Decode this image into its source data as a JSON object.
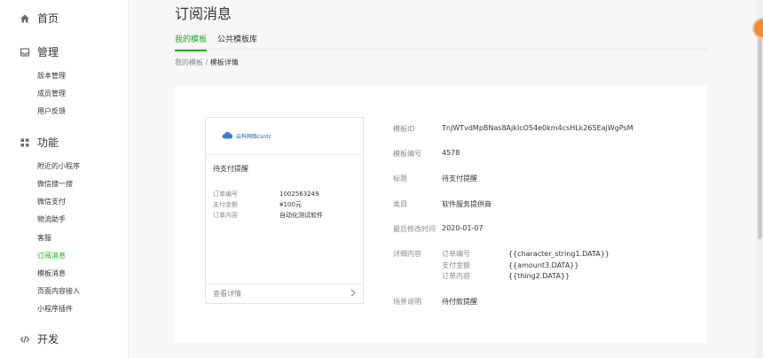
{
  "sidebar": {
    "home": {
      "label": "首页",
      "icon": "home-icon"
    },
    "manage": {
      "label": "管理",
      "icon": "inbox-icon",
      "items": [
        {
          "label": "版本管理"
        },
        {
          "label": "成员管理"
        },
        {
          "label": "用户反馈"
        }
      ]
    },
    "features": {
      "label": "功能",
      "icon": "grid-icon",
      "items": [
        {
          "label": "附近的小程序"
        },
        {
          "label": "微信搜一搜"
        },
        {
          "label": "微信支付"
        },
        {
          "label": "物流助手"
        },
        {
          "label": "客服"
        },
        {
          "label": "订阅消息"
        },
        {
          "label": "模板消息"
        },
        {
          "label": "页面内容接入"
        },
        {
          "label": "小程序插件"
        }
      ]
    },
    "develop": {
      "label": "开发",
      "icon": "code-icon"
    }
  },
  "page": {
    "title": "订阅消息",
    "tabs": [
      {
        "label": "我的模板"
      },
      {
        "label": "公共模板库"
      }
    ],
    "breadcrumb": {
      "parent": "我的模板",
      "separator": "/",
      "current": "模板详情"
    }
  },
  "preview": {
    "logo_text": "云科网络csntc",
    "title": "待支付提醒",
    "rows": [
      {
        "key": "订单编号",
        "value": "1002563249"
      },
      {
        "key": "支付金额",
        "value": "¥100元"
      },
      {
        "key": "订单内容",
        "value": "自动化测试软件"
      }
    ],
    "footer": "查看详情",
    "footer_icon": "chevron-right-icon"
  },
  "detail": {
    "template_id_label": "模板ID",
    "template_id": "TnJWTvdMpBNas8AjkIcO54e0km4csHLk265EajWgPsM",
    "template_no_label": "模板编号",
    "template_no": "4578",
    "title_label": "标题",
    "title": "待支付提醒",
    "category_label": "类目",
    "category": "软件服务提供商",
    "modified_label": "最后修改时间",
    "modified": "2020-01-07",
    "content_label": "详细内容",
    "content": [
      {
        "key": "订单编号",
        "value": "{{character_string1.DATA}}"
      },
      {
        "key": "支付金额",
        "value": "{{amount3.DATA}}"
      },
      {
        "key": "订单内容",
        "value": "{{thing2.DATA}}"
      }
    ],
    "scene_label": "场景说明",
    "scene": "待付款提醒"
  },
  "colors": {
    "accent": "#1aad19",
    "float_badge": "#f08a3c"
  }
}
